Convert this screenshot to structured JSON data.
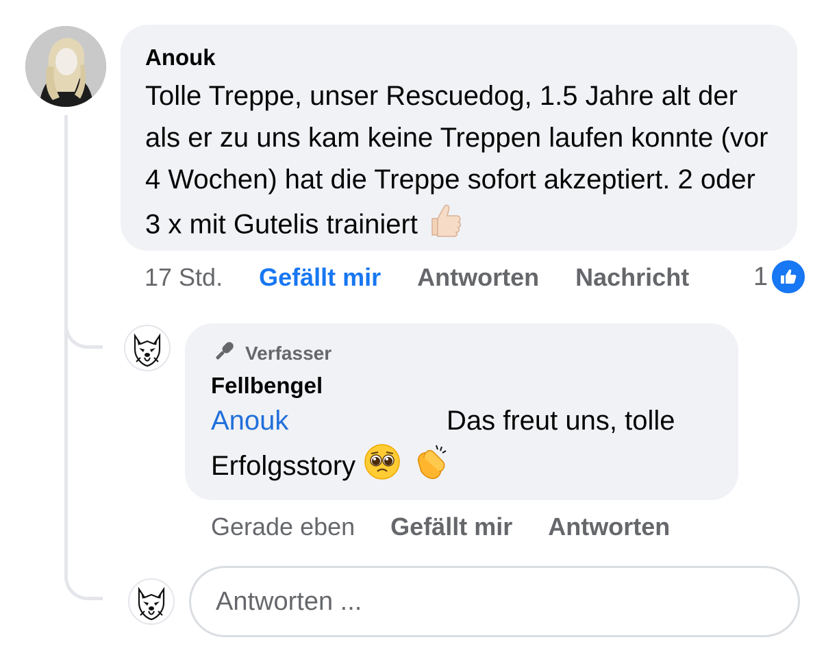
{
  "comment": {
    "author": "Anouk",
    "text": "Tolle Treppe, unser Rescuedog, 1.5 Jahre alt der als er zu uns kam keine Treppen laufen konnte (vor 4 Wochen) hat die Treppe sofort akzeptiert. 2 oder 3 x mit Gutelis trainiert",
    "emoji": "thumbs-up-light-skin",
    "time": "17 Std.",
    "like_label": "Gefällt mir",
    "reply_label": "Antworten",
    "message_label": "Nachricht",
    "like_count": "1",
    "liked": true
  },
  "reply": {
    "badge": "Verfasser",
    "author": "Fellbengel",
    "mention": "Anouk",
    "text_part1": "Das freut uns, tolle",
    "text_part2": "Erfolgsstory",
    "emojis": [
      "pleading-face",
      "clapping-hands"
    ],
    "time": "Gerade eben",
    "like_label": "Gefällt mir",
    "reply_label": "Antworten"
  },
  "reply_box": {
    "placeholder": "Antworten ..."
  },
  "colors": {
    "bubble": "#f0f2f5",
    "link_blue": "#1877f2",
    "mention_blue": "#216fdb",
    "secondary_text": "#65676b"
  }
}
